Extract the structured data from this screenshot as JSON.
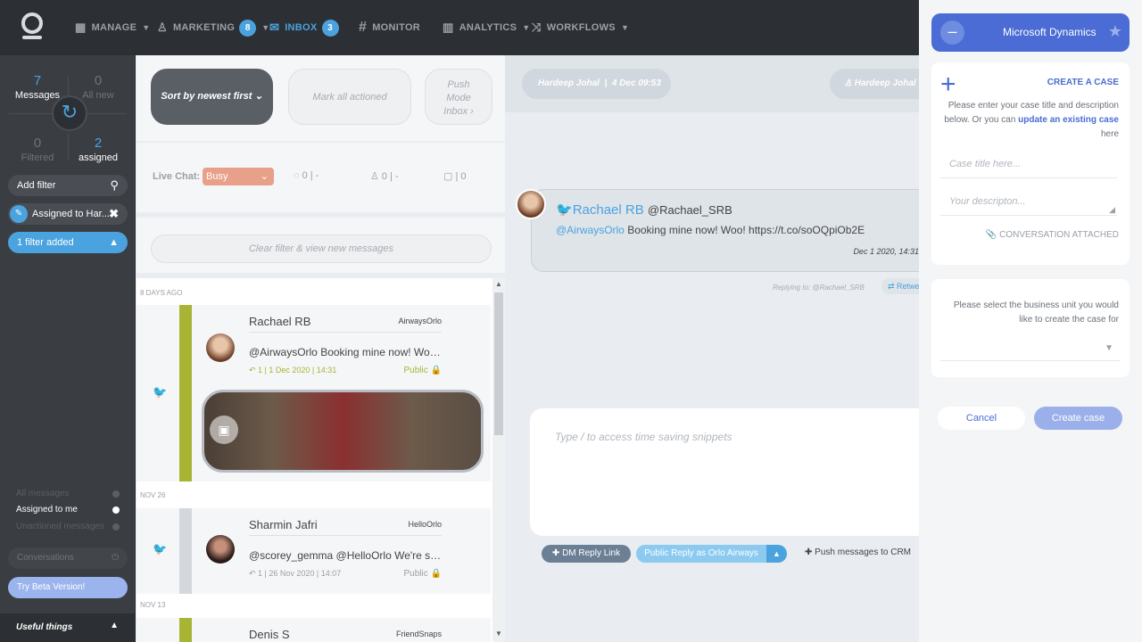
{
  "nav": {
    "manage": "MANAGE",
    "marketing": "MARKETING",
    "marketing_badge": "8",
    "inbox": "INBOX",
    "inbox_badge": "3",
    "monitor": "MONITOR",
    "analytics": "ANALYTICS",
    "workflows": "WORKFLOWS"
  },
  "sidebar": {
    "messages_count": "7",
    "messages_label": "Messages",
    "allnew_count": "0",
    "allnew_label": "All new",
    "filtered_count": "0",
    "filtered_label": "Filtered",
    "assigned_count": "2",
    "assigned_label": "assigned",
    "add_filter": "Add filter",
    "assigned_to": "Assigned to Har...",
    "filter_added": "1 filter added",
    "radio_all": "All messages",
    "radio_me": "Assigned to me",
    "radio_unactioned": "Unactioned messages",
    "conversations": "Conversations",
    "try_beta": "Try Beta Version!",
    "useful": "Useful things"
  },
  "mid": {
    "sort": "Sort by newest first",
    "mark_all": "Mark all actioned",
    "push_mode": "Push Mode Inbox",
    "livechat_label": "Live Chat:",
    "livechat_status": "Busy",
    "count1": "0",
    "count2": "0",
    "count3": "0",
    "dash": "-",
    "clear_filter": "Clear filter & view new messages"
  },
  "messages": [
    {
      "date_label": "8 DAYS AGO",
      "name": "Rachael RB",
      "account": "AirwaysOrlo",
      "text": "@AirwaysOrlo Booking mine now! Woo! ...",
      "meta": "1 | 1 Dec 2020 | 14:31",
      "visibility": "Public",
      "strip_color": "#a8b534"
    },
    {
      "date_label": "NOV 26",
      "name": "Sharmin Jafri",
      "account": "HelloOrlo",
      "text": "@scorey_gemma @HelloOrlo We're seei...",
      "meta": "1 | 26 Nov 2020 | 14:07",
      "visibility": "Public",
      "strip_color": "#d4d8dd"
    },
    {
      "date_label": "NOV 13",
      "name": "Denis S",
      "account": "FriendSnaps",
      "strip_color": "#a8b534"
    }
  ],
  "convo": {
    "header_name": "Hardeep Johal",
    "header_date": "4 Dec 09:53",
    "header_sep": "|",
    "assignee": "Hardeep Johal",
    "tweet_name": "Rachael RB",
    "tweet_handle": "@Rachael_SRB",
    "tweet_mention": "@AirwaysOrlo",
    "tweet_text": "Booking mine now! Woo! https://t.co/soOQpiOb2E",
    "tweet_date": "Dec 1 2020, 14:31",
    "replying_to": "Replying to: @Rachael_SRB",
    "retweet": "Retwe",
    "reply_placeholder": "Type / to access time saving snippets",
    "dm_reply": "DM Reply Link",
    "public_reply": "Public Reply as Orlo Airways",
    "push_crm": "Push messages to CRM"
  },
  "crm": {
    "title": "Microsoft Dynamics",
    "create_case": "CREATE A CASE",
    "instructions_1": "Please enter your case title and description below. Or you can",
    "update_link": "update an existing case",
    "instructions_2": "here",
    "title_placeholder": "Case title here...",
    "desc_placeholder": "Your descripton...",
    "conversation_attached": "CONVERSATION ATTACHED",
    "business_unit_text": "Please select the business unit you would like to create the case for",
    "cancel": "Cancel",
    "create": "Create case"
  },
  "colors": {
    "accent": "#4aa3df",
    "crm_header": "#4a6cd4",
    "busy": "#e8a08a"
  }
}
